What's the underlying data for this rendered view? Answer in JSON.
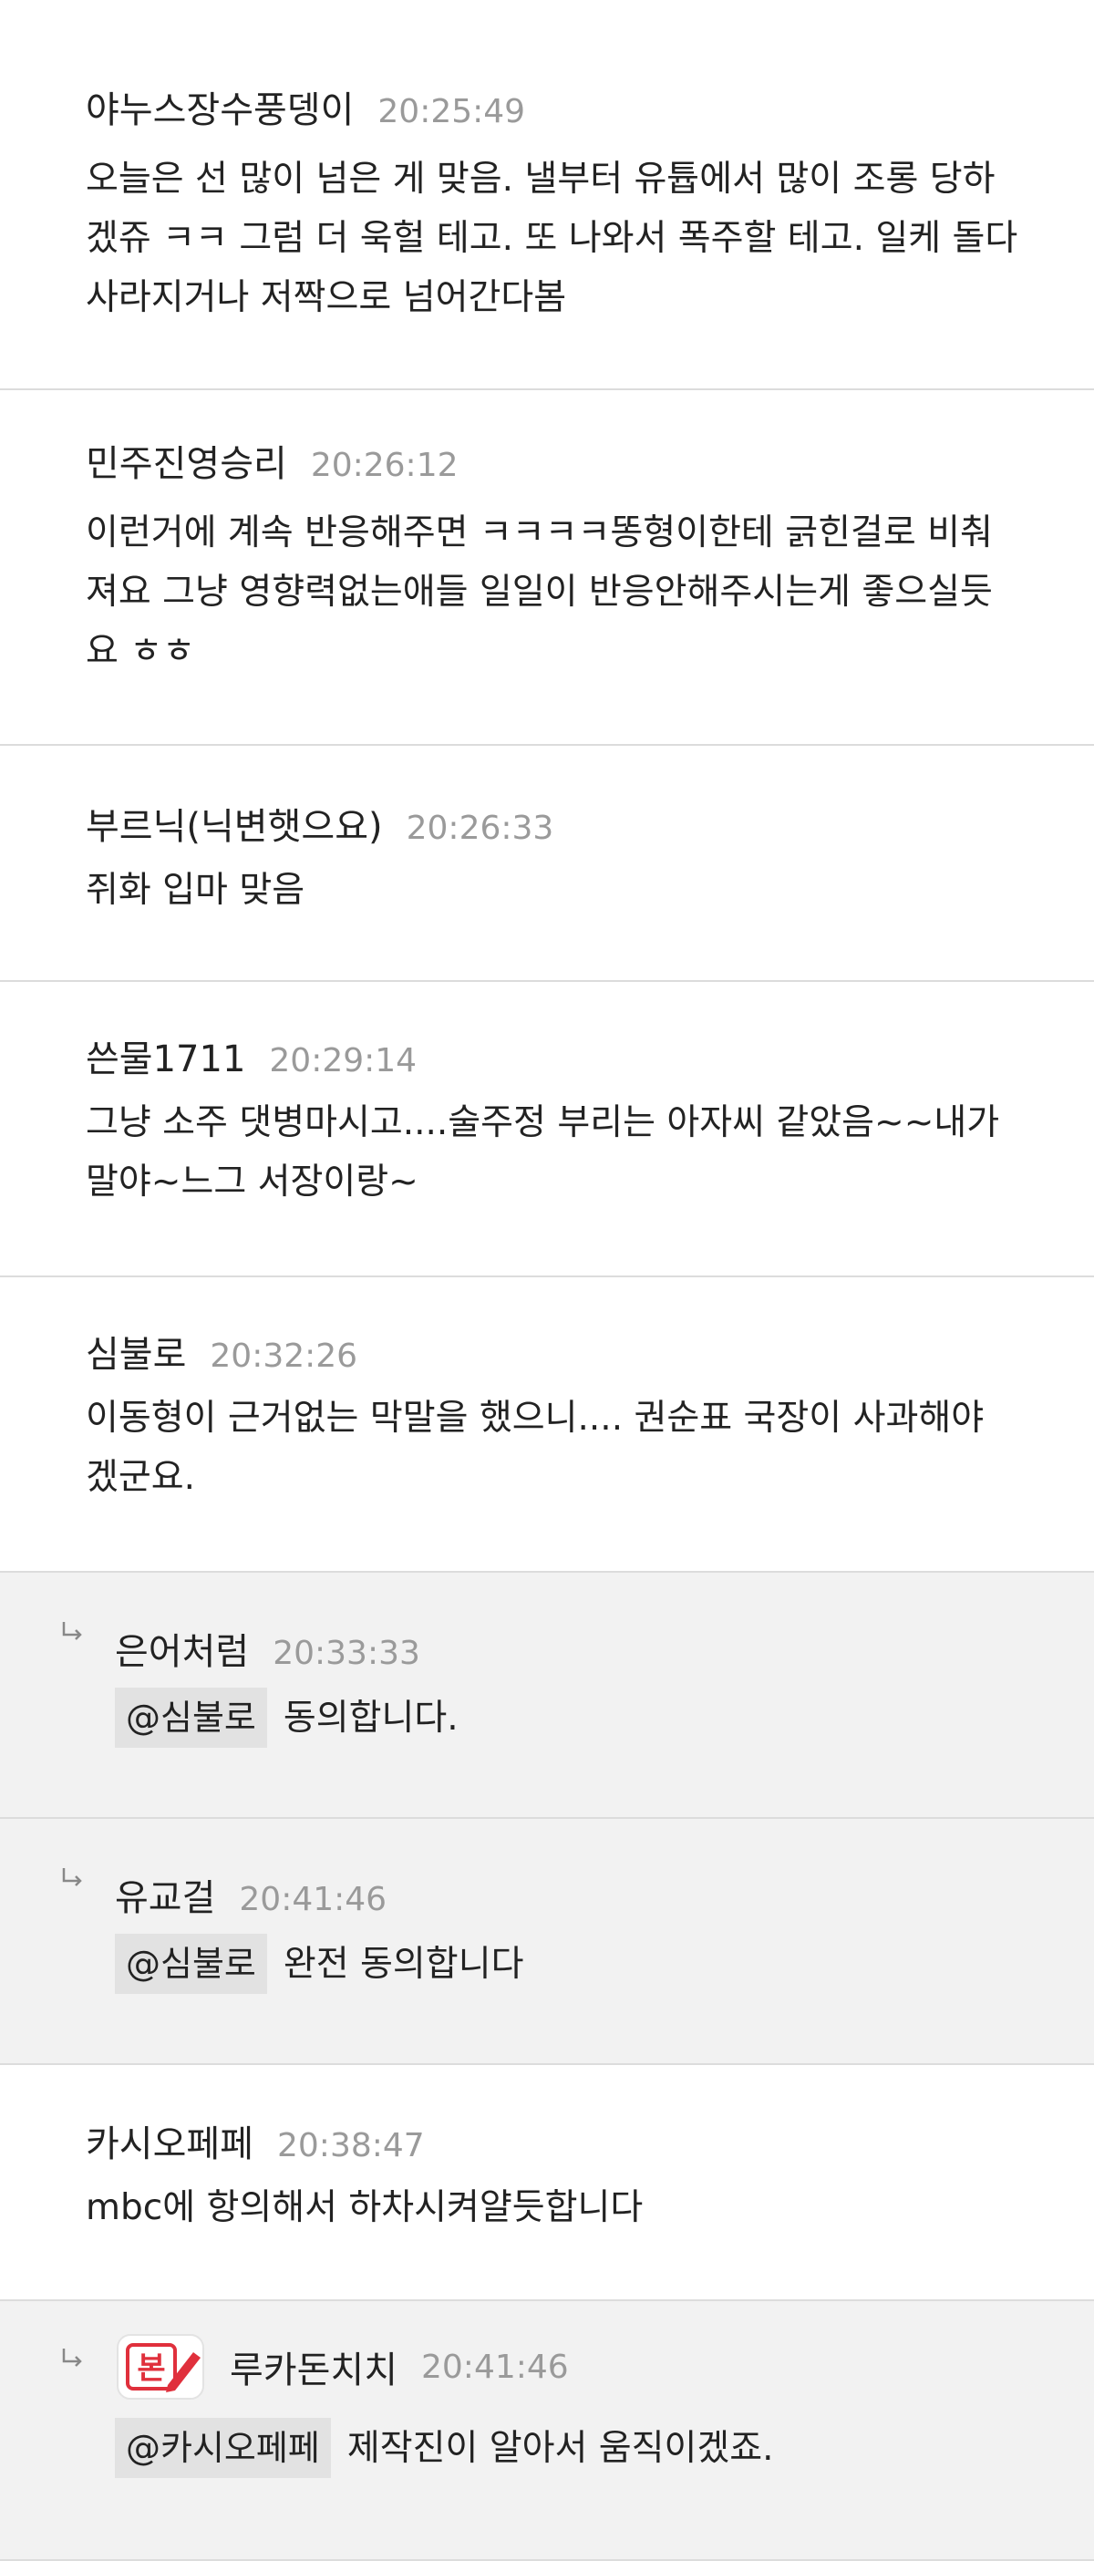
{
  "comments": [
    {
      "author": "야누스장수풍뎅이",
      "time": "20:25:49",
      "lines": [
        "오늘은 선 많이 넘은 게 맞음. 낼부터 유튭에서 많이 조롱 당하",
        "겠쥬 ㅋㅋ 그럼 더 욱헐 테고. 또 나와서 폭주할 테고. 일케 돌다",
        "사라지거나 저짝으로 넘어간다봄"
      ]
    },
    {
      "author": "민주진영승리",
      "time": "20:26:12",
      "lines": [
        "이런거에 계속 반응해주면 ㅋㅋㅋㅋ똥형이한테 긁힌걸로 비춰",
        "져요 그냥 영향력없는애들 일일이 반응안해주시는게 좋으실듯",
        "요 ㅎㅎ"
      ]
    },
    {
      "author": "부르닉(닉변햇으요)",
      "time": "20:26:33",
      "lines": [
        "쥐화 입마 맞음"
      ]
    },
    {
      "author": "쓴물1711",
      "time": "20:29:14",
      "lines": [
        "그냥 소주 댓병마시고....술주정 부리는 아자씨 같았음~~내가",
        "말야~느그 서장이랑~"
      ]
    },
    {
      "author": "심불로",
      "time": "20:32:26",
      "lines": [
        "이동형이 근거없는 막말을 했으니.... 권순표 국장이 사과해야",
        "겠군요."
      ]
    }
  ],
  "replies": [
    {
      "author": "은어처럼",
      "time": "20:33:33",
      "mention": "@심불로",
      "text": "동의합니다."
    },
    {
      "author": "유교걸",
      "time": "20:41:46",
      "mention": "@심불로",
      "text": "완전 동의합니다"
    }
  ],
  "comment6": {
    "author": "카시오페페",
    "time": "20:38:47",
    "text": "mbc에 항의해서 하차시켜얄듯합니다"
  },
  "reply3": {
    "author": "루카돈치치",
    "time": "20:41:46",
    "mention": "@카시오페페",
    "text": "제작진이 알아서 움직이겠죠.",
    "badge_text": "본"
  },
  "colors": {
    "reply_bg": "#f2f2f2",
    "divider": "#dcdcdc",
    "time": "#9a9a9a",
    "mention_bg": "#e2e2e2",
    "badge": "#e0303c"
  }
}
